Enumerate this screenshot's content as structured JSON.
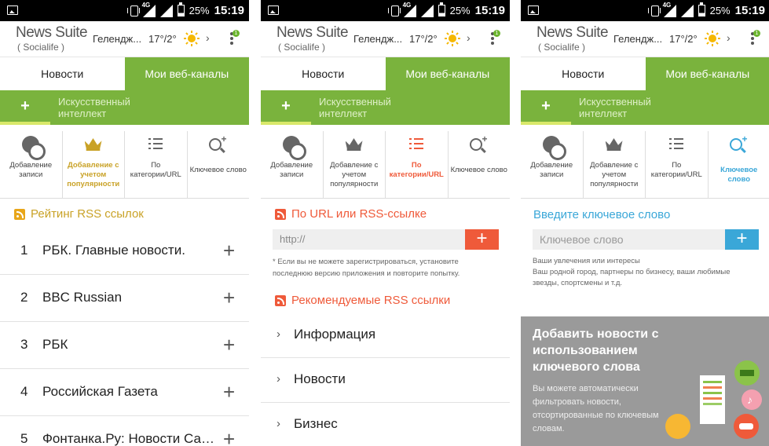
{
  "status": {
    "network": "4G",
    "battery": "25%",
    "time": "15:19"
  },
  "app": {
    "title": "News Suite",
    "subtitle": "( Socialife )",
    "city": "Гелендж...",
    "temp": "17°/2°",
    "badge": "1"
  },
  "tabs": [
    "Новости",
    "Мои веб-каналы"
  ],
  "green_bar": {
    "plus": "+",
    "label_line1": "Искусственный",
    "label_line2": "интеллект"
  },
  "options": [
    {
      "lines": [
        "Добавление",
        "записи"
      ]
    },
    {
      "lines": [
        "Добавление с",
        "учетом",
        "популярности"
      ]
    },
    {
      "lines": [
        "По",
        "категории/URL"
      ]
    },
    {
      "lines": [
        "Ключевое слово"
      ]
    }
  ],
  "screen1": {
    "heading": "Рейтинг RSS ссылок",
    "items": [
      {
        "n": "1",
        "title": "РБК. Главные новости."
      },
      {
        "n": "2",
        "title": "BBC Russian"
      },
      {
        "n": "3",
        "title": "РБК"
      },
      {
        "n": "4",
        "title": "Российская Газета"
      },
      {
        "n": "5",
        "title": "Фонтанка.Ру: Новости Сан..."
      }
    ],
    "plus": "+"
  },
  "screen2": {
    "heading": "По URL или RSS-ссылке",
    "placeholder": "http://",
    "plus": "+",
    "note_line1": "* Если вы не можете зарегистрироваться, установите",
    "note_line2": "последнюю версию приложения и повторите попытку.",
    "rec_heading": "Рекомендуемые RSS ссылки",
    "categories": [
      "Информация",
      "Новости",
      "Бизнес"
    ]
  },
  "screen3": {
    "heading": "Введите ключевое слово",
    "placeholder": "Ключевое слово",
    "plus": "+",
    "hint_line1": "Ваши увлечения или интересы",
    "hint_line2": "Ваш родной город, партнеры по бизнесу, ваши любимые",
    "hint_line3": "звезды, спортсмены и т.д.",
    "promo_title": "Добавить новости с использованием ключевого слова",
    "promo_desc": "Вы можете автоматически фильтровать новости, отсортированные по ключевым словам."
  },
  "colors": {
    "green": "#7ab33d",
    "gold": "#c9a227",
    "orange": "#ef5a3a",
    "blue": "#3aa7d8"
  }
}
